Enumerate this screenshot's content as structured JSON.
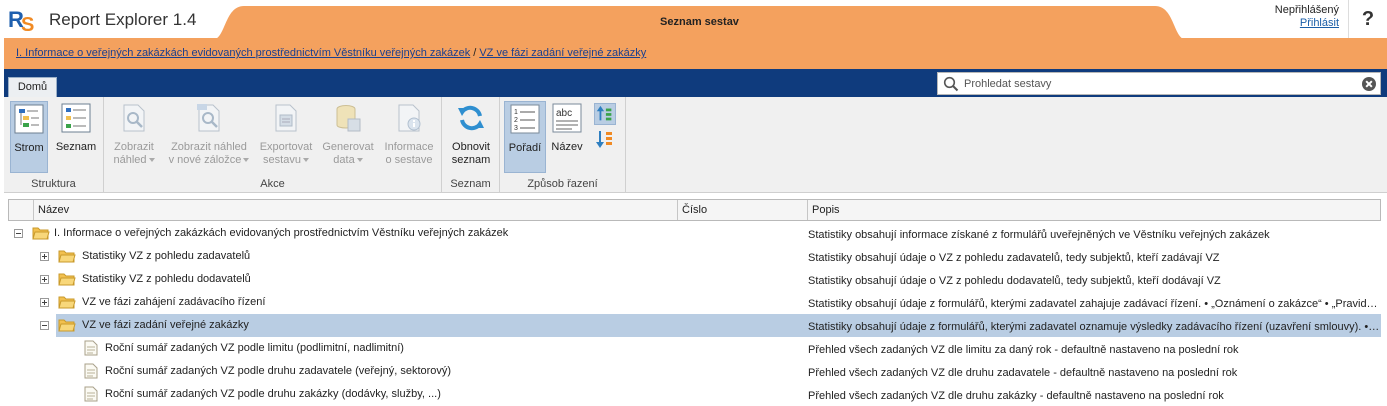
{
  "app": {
    "title": "Report Explorer 1.4",
    "page_tab": "Seznam sestav",
    "login_status": "Nepřihlášený",
    "login_link": "Přihlásit",
    "help": "?"
  },
  "breadcrumb": {
    "items": [
      "I. Informace o veřejných zakázkách evidovaných prostřednictvím Věstníku veřejných zakázek",
      "VZ ve fázi zadání veřejné zakázky"
    ],
    "separator": "/"
  },
  "nav": {
    "tab_home": "Domů",
    "search_placeholder": "Prohledat sestavy"
  },
  "ribbon": {
    "groups": {
      "structure": "Struktura",
      "actions": "Akce",
      "list": "Seznam",
      "sorting": "Způsob řazení"
    },
    "buttons": {
      "tree": "Strom",
      "list": "Seznam",
      "preview_1": "Zobrazit",
      "preview_2": "náhled",
      "preview_tab_1": "Zobrazit náhled",
      "preview_tab_2": "v nové záložce",
      "export_1": "Exportovat",
      "export_2": "sestavu",
      "generate_1": "Generovat",
      "generate_2": "data",
      "info_1": "Informace",
      "info_2": "o sestave",
      "refresh_1": "Obnovit",
      "refresh_2": "seznam",
      "order": "Pořadí",
      "name": "Název",
      "name_icon_text": "abc"
    }
  },
  "grid": {
    "columns": [
      "Název",
      "Číslo",
      "Popis"
    ],
    "rows": [
      {
        "name": "I. Informace o veřejných zakázkách evidovaných prostřednictvím Věstníku veřejných zakázek",
        "number": "",
        "description": "Statistiky obsahují informace získané z formulářů uveřejněných ve Věstníku veřejných zakázek"
      },
      {
        "name": "Statistiky VZ z pohledu zadavatelů",
        "number": "",
        "description": "Statistiky obsahují údaje o VZ z pohledu zadavatelů, tedy subjektů, kteří zadávají VZ"
      },
      {
        "name": "Statistiky VZ z pohledu dodavatelů",
        "number": "",
        "description": "Statistiky obsahují údaje o VZ z pohledu dodavatelů, tedy subjektů, kteří dodávají VZ"
      },
      {
        "name": "VZ ve fázi zahájení zadávacího řízení",
        "number": "",
        "description": "Statistiky obsahují údaje z formulářů, kterými zadavatel zahajuje zadávací řízení. • „Oznámení o zakázce“ • „Pravid…"
      },
      {
        "name": "VZ ve fázi zadání veřejné zakázky",
        "number": "",
        "description": "Statistiky obsahují údaje z formulářů, kterými zadavatel oznamuje výsledky zadávacího řízení (uzavření smlouvy). •…"
      },
      {
        "name": "Roční sumář zadaných VZ podle limitu (podlimitní, nadlimitní)",
        "number": "",
        "description": "Přehled všech zadaných VZ dle limitu za daný rok - defaultně nastaveno na poslední rok"
      },
      {
        "name": "Roční sumář zadaných VZ podle druhu zadavatele (veřejný, sektorový)",
        "number": "",
        "description": "Přehled všech zadaných VZ dle druhu zadavatele - defaultně nastaveno na poslední rok"
      },
      {
        "name": "Roční sumář zadaných VZ podle druhu zakázky (dodávky, služby, ...)",
        "number": "",
        "description": "Přehled všech zadaných VZ dle druhu zakázky - defaultně nastaveno na poslední rok"
      }
    ]
  },
  "colors": {
    "accent_orange": "#f4a15e",
    "nav_blue": "#0f3b7d",
    "selection": "#b9cde3",
    "folder": "#f2c04f"
  }
}
